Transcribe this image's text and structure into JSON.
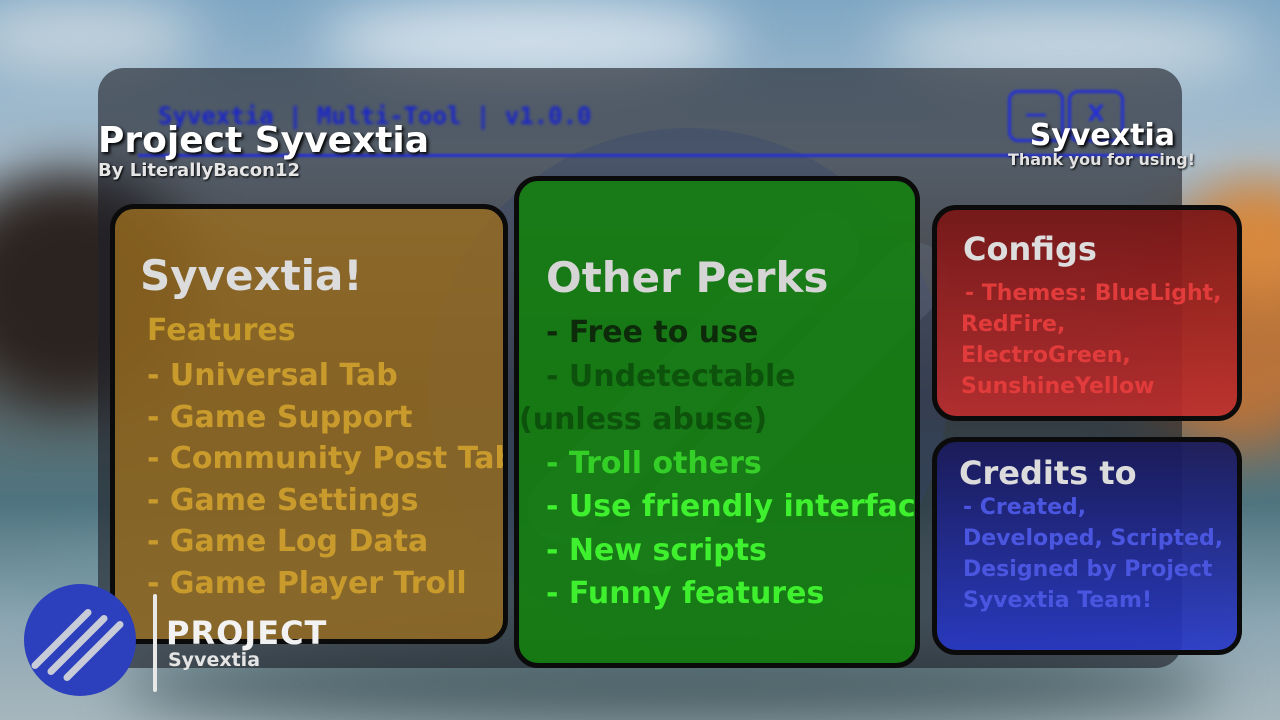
{
  "ghost_window": {
    "title": "Syvextia | Multi-Tool | v1.0.0",
    "min_label": "—",
    "close_label": "X"
  },
  "header": {
    "title": "Project Syvextia",
    "author": "By LiterallyBacon12",
    "brand": "Syvextia",
    "brand_subtitle": "Thank you for using!"
  },
  "features_card": {
    "title": "Syvextia!",
    "subtitle": "Features",
    "items": [
      "- Universal Tab",
      "- Game Support",
      "- Community Post Tab",
      "- Game Settings",
      "- Game Log Data",
      "- Game Player Troll"
    ]
  },
  "perks_card": {
    "title": "Other Perks",
    "items": [
      "- Free to use",
      "- Undetectable",
      "(unless abuse)",
      "- Troll others",
      "- Use friendly interface",
      "- New scripts",
      "- Funny features"
    ]
  },
  "configs_card": {
    "title": "Configs",
    "items": [
      "- Themes: BlueLight,",
      "RedFire,",
      "ElectroGreen,",
      "SunshineYellow"
    ]
  },
  "credits_card": {
    "title": "Credits to",
    "text": "- Created, Developed, Scripted, Designed by Project Syvextia Team!"
  },
  "logo": {
    "word": "PROJECT",
    "sub": "Syvextia"
  },
  "colors": {
    "features_bg": "#9c6e1e",
    "perks_bg": "#12820a",
    "configs_bg": "#be2d2d",
    "credits_bg": "#2637c8",
    "perks_text_bright": "#3ff02e",
    "logo_circle": "#2c3fbd"
  }
}
